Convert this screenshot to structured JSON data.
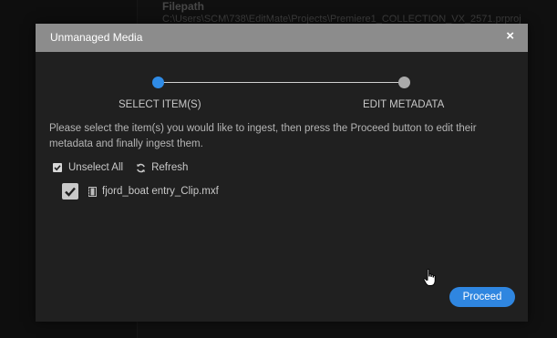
{
  "background": {
    "column_header": "Filepath",
    "path_text": "C:\\Users\\SCM\\738\\EditMate\\Projects\\Premiere1_COLLECTION_VX_2571.prproj"
  },
  "dialog": {
    "title": "Unmanaged Media",
    "close_glyph": "×",
    "steps": [
      {
        "label": "SELECT ITEM(S)",
        "active": true
      },
      {
        "label": "EDIT METADATA",
        "active": false
      }
    ],
    "instructions": "Please select the item(s) you would like to ingest, then press the Proceed button to edit their metadata and finally ingest them.",
    "unselect_all_label": "Unselect All",
    "refresh_label": "Refresh",
    "files": [
      {
        "name": "fjord_boat entry_Clip.mxf",
        "checked": true
      }
    ],
    "proceed_label": "Proceed"
  },
  "colors": {
    "accent": "#2f86e0",
    "titlebar": "#8c8c8c",
    "dialog_bg": "#202020",
    "step_inactive": "#aaaaaa"
  },
  "icons": [
    "checkbox-checked-icon",
    "refresh-icon",
    "film-icon",
    "close-icon",
    "hand-cursor-icon"
  ]
}
